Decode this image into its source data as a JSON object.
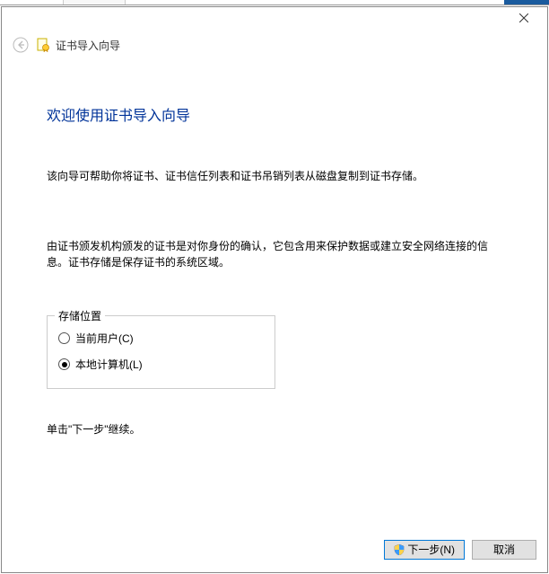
{
  "header": {
    "wizard_title": "证书导入向导"
  },
  "main": {
    "heading": "欢迎使用证书导入向导",
    "para1": "该向导可帮助你将证书、证书信任列表和证书吊销列表从磁盘复制到证书存储。",
    "para2": "由证书颁发机构颁发的证书是对你身份的确认，它包含用来保护数据或建立安全网络连接的信息。证书存储是保存证书的系统区域。",
    "storage": {
      "legend": "存储位置",
      "current_user_label": "当前用户(C)",
      "local_machine_label": "本地计算机(L)",
      "selected": "local_machine"
    },
    "hint": "单击\"下一步\"继续。"
  },
  "footer": {
    "next_label": "下一步(N)",
    "cancel_label": "取消"
  }
}
